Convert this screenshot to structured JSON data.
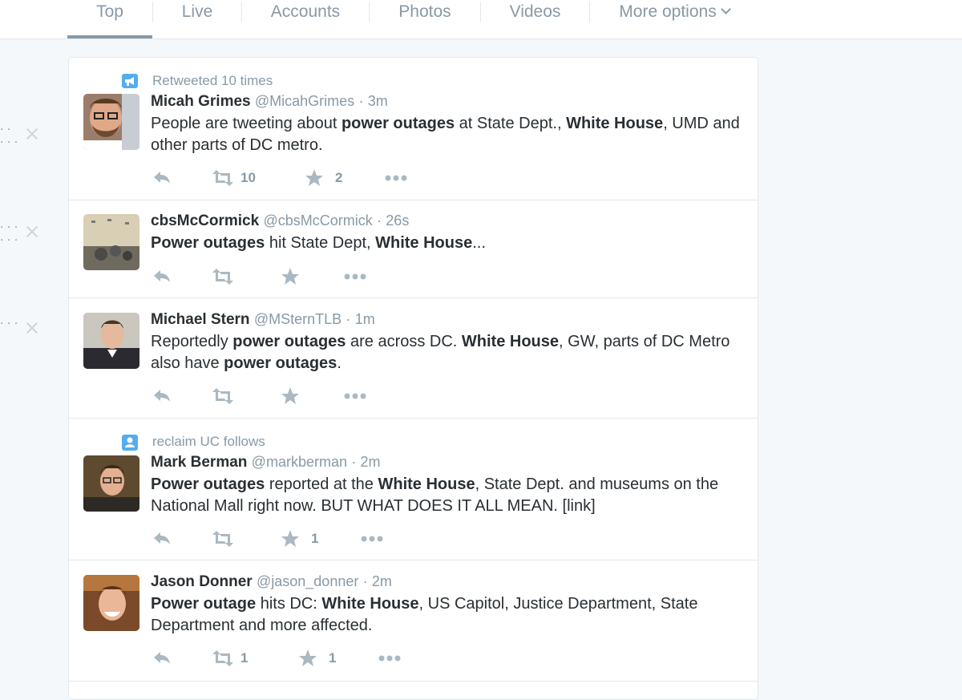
{
  "tabs": [
    {
      "label": "Top"
    },
    {
      "label": "Live"
    },
    {
      "label": "Accounts"
    },
    {
      "label": "Photos"
    },
    {
      "label": "Videos"
    },
    {
      "label": "More options"
    }
  ],
  "left_column": {
    "rows": [
      {
        "dots": ". .\n. . ."
      },
      {
        "dots": ". . .\n. . ."
      },
      {
        "dots": ". . ."
      }
    ]
  },
  "tweets": [
    {
      "context": "Retweeted 10 times",
      "context_icon": "retweet-megaphone-icon",
      "name": "Micah Grimes",
      "handle": "@MicahGrimes",
      "sep": "·",
      "time": "3m",
      "text_parts": [
        "People are tweeting about ",
        "power outages",
        " at State Dept., ",
        "White House",
        ", UMD and other parts of DC metro."
      ],
      "retweets": "10",
      "favorites": "2"
    },
    {
      "context": "",
      "name": "cbsMcCormick",
      "handle": "@cbsMcCormick",
      "sep": "·",
      "time": "26s",
      "text_parts": [
        "Power outages",
        " hit State Dept, ",
        "White House",
        "..."
      ],
      "retweets": "",
      "favorites": ""
    },
    {
      "context": "",
      "name": "Michael Stern",
      "handle": "@MSternTLB",
      "sep": "·",
      "time": "1m",
      "text_parts": [
        "Reportedly ",
        "power outages",
        " are across DC. ",
        "White House",
        ", GW, parts of DC Metro also have ",
        "power outages",
        "."
      ],
      "retweets": "",
      "favorites": ""
    },
    {
      "context": "reclaim UC follows",
      "context_icon": "person-follow-icon",
      "name": "Mark Berman",
      "handle": "@markberman",
      "sep": "·",
      "time": "2m",
      "text_parts": [
        "Power outages",
        " reported at the ",
        "White House",
        ", State Dept. and museums on the National Mall right now. BUT WHAT DOES IT ALL MEAN. [link]"
      ],
      "retweets": "",
      "favorites": "1"
    },
    {
      "context": "",
      "name": "Jason Donner",
      "handle": "@jason_donner",
      "sep": "·",
      "time": "2m",
      "text_parts": [
        "Power outage",
        " hits DC: ",
        "White House",
        ", US Capitol, Justice Department, State Department and more affected."
      ],
      "retweets": "1",
      "favorites": "1"
    }
  ],
  "colors": {
    "accent": "#55acee",
    "muted": "#8899a6",
    "icon": "#aab8c2",
    "border": "#e1e8ed",
    "text": "#292f33"
  }
}
